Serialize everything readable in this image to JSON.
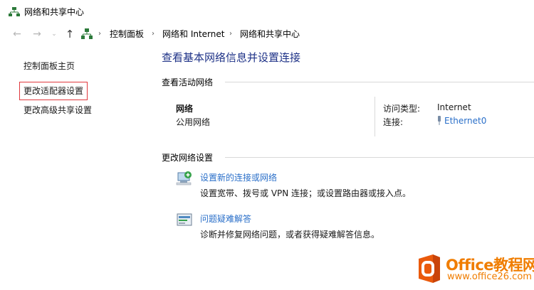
{
  "window": {
    "title": "网络和共享中心"
  },
  "address_bar": {
    "crumbs": [
      "控制面板",
      "网络和 Internet",
      "网络和共享中心"
    ]
  },
  "sidebar": {
    "items": [
      {
        "label": "控制面板主页"
      },
      {
        "label": "更改适配器设置"
      },
      {
        "label": "更改高级共享设置"
      }
    ]
  },
  "main": {
    "title": "查看基本网络信息并设置连接",
    "active_networks_heading": "查看活动网络",
    "network": {
      "name": "网络",
      "type": "公用网络",
      "access_type_label": "访问类型:",
      "access_type_value": "Internet",
      "connection_label": "连接:",
      "connection_value": "Ethernet0"
    },
    "change_settings_heading": "更改网络设置",
    "tasks": [
      {
        "link": "设置新的连接或网络",
        "desc": "设置宽带、拨号或 VPN 连接；或设置路由器或接入点。",
        "icon": "new-connection-icon"
      },
      {
        "link": "问题疑难解答",
        "desc": "诊断并修复网络问题，或者获得疑难解答信息。",
        "icon": "troubleshoot-icon"
      }
    ]
  },
  "watermark": {
    "brand": "Office教程网",
    "url": "www.office26.com"
  },
  "colors": {
    "link": "#2a6fc9",
    "title": "#1e3287",
    "highlight_border": "#e0393e",
    "watermark": "#f07d00"
  }
}
